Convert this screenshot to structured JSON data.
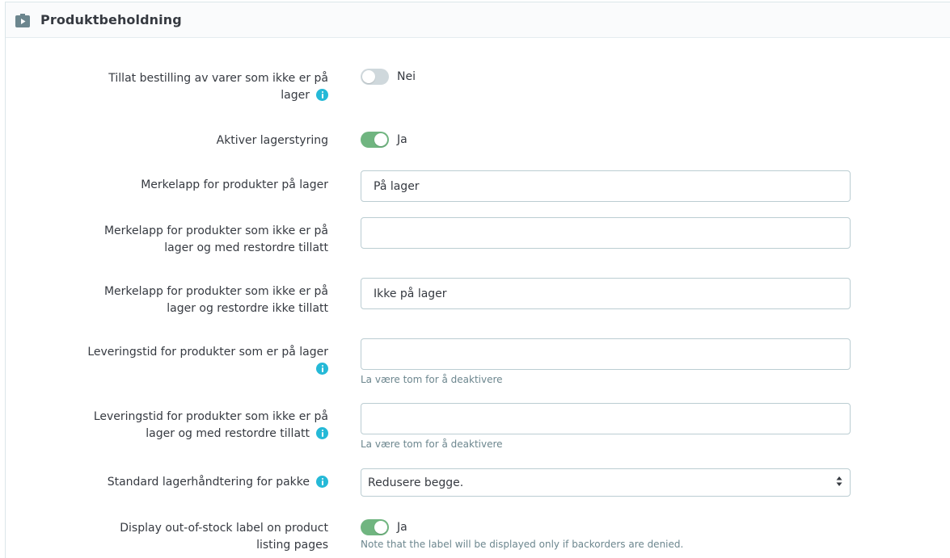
{
  "panel": {
    "title": "Produktbeholdning",
    "icon": "box-play-icon"
  },
  "fields": {
    "allow_backorder": {
      "label": "Tillat bestilling av varer som ikke er på lager",
      "value_text": "Nei",
      "enabled": false
    },
    "stock_management": {
      "label": "Aktiver lagerstyring",
      "value_text": "Ja",
      "enabled": true
    },
    "label_in_stock": {
      "label": "Merkelapp for produkter på lager",
      "value": "På lager"
    },
    "label_oos_backorder_allowed": {
      "label": "Merkelapp for produkter som ikke er på lager og med restordre tillatt",
      "value": ""
    },
    "label_oos_backorder_denied": {
      "label": "Merkelapp for produkter som ikke er på lager og restordre ikke tillatt",
      "value": "Ikke på lager"
    },
    "delivery_in_stock": {
      "label": "Leveringstid for produkter som er på lager",
      "value": "",
      "help": "La være tom for å deaktivere"
    },
    "delivery_oos_backorder": {
      "label": "Leveringstid for produkter som ikke er på lager og med restordre tillatt",
      "value": "",
      "help": "La være tom for å deaktivere"
    },
    "pack_stock": {
      "label": "Standard lagerhåndtering for pakke",
      "selected": "Redusere begge."
    },
    "display_oos_label": {
      "label": "Display out-of-stock label on product listing pages",
      "value_text": "Ja",
      "enabled": true,
      "note": "Note that the label will be displayed only if backorders are denied."
    }
  },
  "colors": {
    "accent_info": "#25b9d7",
    "switch_on": "#70b580",
    "switch_off": "#cfd8dc",
    "border": "#bbcdd2"
  }
}
